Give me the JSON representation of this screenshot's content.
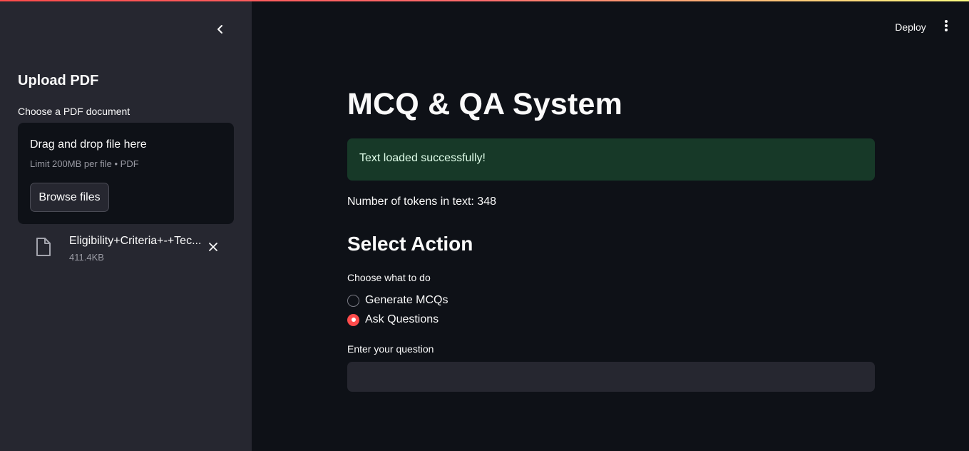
{
  "sidebar": {
    "title": "Upload PDF",
    "uploader": {
      "label": "Choose a PDF document",
      "drop_title": "Drag and drop file here",
      "limit": "Limit 200MB per file • PDF",
      "browse_label": "Browse files"
    },
    "file": {
      "name": "Eligibility+Criteria+-+Tec...",
      "size": "411.4KB"
    }
  },
  "header": {
    "deploy_label": "Deploy"
  },
  "main": {
    "title": "MCQ & QA System",
    "success_message": "Text loaded successfully!",
    "token_text": "Number of tokens in text: 348",
    "section_title": "Select Action",
    "radio": {
      "label": "Choose what to do",
      "options": [
        {
          "label": "Generate MCQs",
          "selected": false
        },
        {
          "label": "Ask Questions",
          "selected": true
        }
      ]
    },
    "question": {
      "label": "Enter your question",
      "value": ""
    }
  },
  "colors": {
    "accent": "#ff4b4b",
    "background": "#0e1117",
    "sidebar": "#262730",
    "success_bg": "#173928"
  }
}
